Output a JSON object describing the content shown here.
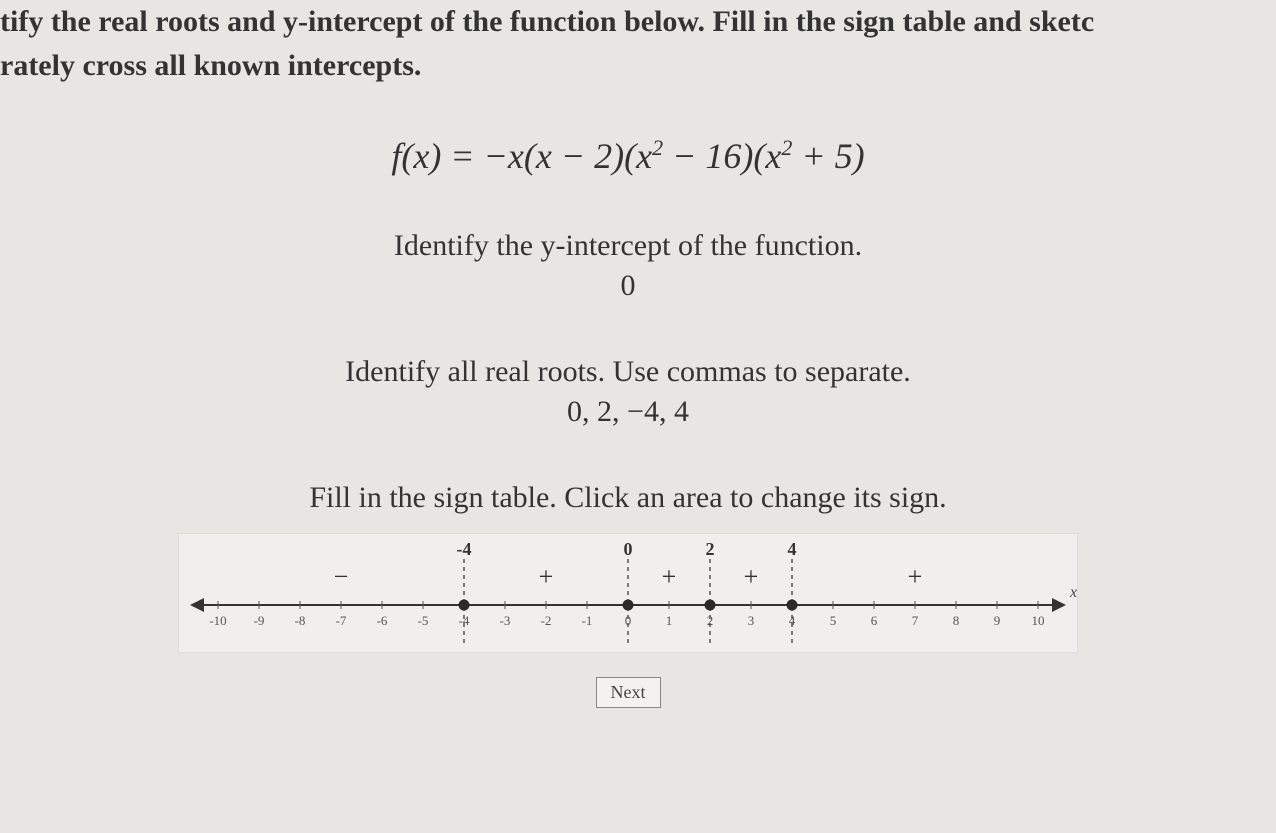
{
  "intro": {
    "line1": "tify the real roots and y-intercept of the function below. Fill in the sign table and sketc",
    "line2": "rately cross all known intercepts."
  },
  "formula": "f(x) = −x(x − 2)(x² − 16)(x² + 5)",
  "yint": {
    "prompt": "Identify the y-intercept of the function.",
    "value": "0"
  },
  "roots": {
    "prompt": "Identify all real roots. Use commas to separate.",
    "value": "0, 2, −4, 4"
  },
  "signtable": {
    "prompt": "Fill in the sign table. Click an area to change its sign.",
    "ticks": [
      "-10",
      "-9",
      "-8",
      "-7",
      "-6",
      "-5",
      "-4",
      "-3",
      "-2",
      "-1",
      "0",
      "1",
      "2",
      "3",
      "4",
      "5",
      "6",
      "7",
      "8",
      "9",
      "10"
    ],
    "roots": [
      {
        "value": -4,
        "label": "-4"
      },
      {
        "value": 0,
        "label": "0"
      },
      {
        "value": 2,
        "label": "2"
      },
      {
        "value": 4,
        "label": "4"
      }
    ],
    "regions": [
      {
        "from": -10,
        "to": -4,
        "sign": "−"
      },
      {
        "from": -4,
        "to": 0,
        "sign": "+"
      },
      {
        "from": 0,
        "to": 2,
        "sign": "+"
      },
      {
        "from": 2,
        "to": 4,
        "sign": "+"
      },
      {
        "from": 4,
        "to": 10,
        "sign": "+"
      }
    ],
    "axis_label": "x"
  },
  "next_label": "Next"
}
